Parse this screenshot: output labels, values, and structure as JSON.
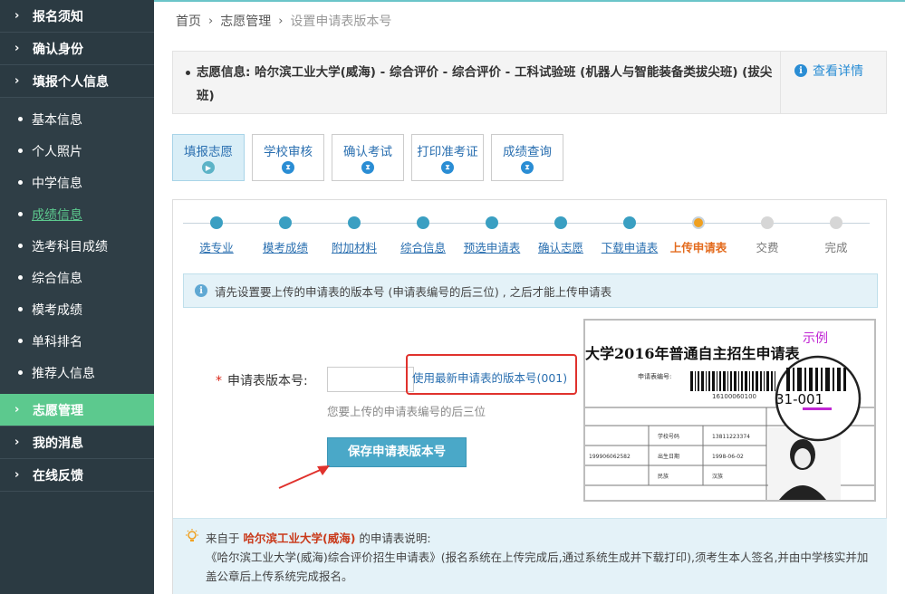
{
  "sidebar": {
    "top_items": [
      {
        "label": "报名须知"
      },
      {
        "label": "确认身份"
      },
      {
        "label": "填报个人信息"
      }
    ],
    "sub_items": [
      {
        "label": "基本信息"
      },
      {
        "label": "个人照片"
      },
      {
        "label": "中学信息"
      },
      {
        "label": "成绩信息"
      },
      {
        "label": "选考科目成绩"
      },
      {
        "label": "综合信息"
      },
      {
        "label": "模考成绩"
      },
      {
        "label": "单科排名"
      },
      {
        "label": "推荐人信息"
      }
    ],
    "bottom_items": [
      {
        "label": "志愿管理"
      },
      {
        "label": "我的消息"
      },
      {
        "label": "在线反馈"
      }
    ]
  },
  "breadcrumb": {
    "home": "首页",
    "section": "志愿管理",
    "current": "设置申请表版本号"
  },
  "info": {
    "text": "志愿信息: 哈尔滨工业大学(威海) - 综合评价 - 综合评价 - 工科试验班 (机器人与智能装备类拔尖班) (拔尖班)",
    "detail_link": "查看详情"
  },
  "tabs": [
    {
      "label": "填报志愿"
    },
    {
      "label": "学校审核"
    },
    {
      "label": "确认考试"
    },
    {
      "label": "打印准考证"
    },
    {
      "label": "成绩查询"
    }
  ],
  "progress": [
    {
      "label": "选专业"
    },
    {
      "label": "模考成绩"
    },
    {
      "label": "附加材料"
    },
    {
      "label": "综合信息"
    },
    {
      "label": "预选申请表"
    },
    {
      "label": "确认志愿"
    },
    {
      "label": "下载申请表"
    },
    {
      "label": "上传申请表"
    },
    {
      "label": "交费"
    },
    {
      "label": "完成"
    }
  ],
  "notice": "请先设置要上传的申请表的版本号 (申请表编号的后三位) , 之后才能上传申请表",
  "form": {
    "label": "申请表版本号:",
    "required_mark": "*",
    "input_value": "",
    "latest_link": "使用最新申请表的版本号(001)",
    "helper": "您要上传的申请表编号的后三位",
    "save_button": "保存申请表版本号"
  },
  "example": {
    "tag": "示例",
    "title": "大学2016年普通自主招生申请表",
    "code_label": "申请表编号:",
    "barcode_number": "16100060100",
    "zoom_text": "31-001",
    "row_labels": [
      "学校号码",
      "出生日期",
      "民族"
    ],
    "row_values": [
      "13811223374",
      "1998-06-02",
      "汉族"
    ],
    "left_value": "199906062582"
  },
  "bottom_note": {
    "prefix": "来自于",
    "university": "哈尔滨工业大学(威海)",
    "suffix": "的申请表说明:",
    "body": "《哈尔滨工业大学(威海)综合评价招生申请表》(报名系统在上传完成后,通过系统生成并下载打印),须考生本人签名,并由中学核实并加盖公章后上传系统完成报名。"
  },
  "colors": {
    "sidebar_bg": "#2b3a42",
    "active_green": "#5cc98e",
    "link_blue": "#2a6fb0",
    "highlight_red": "#e0322d",
    "current_step_orange": "#e36b1e"
  }
}
